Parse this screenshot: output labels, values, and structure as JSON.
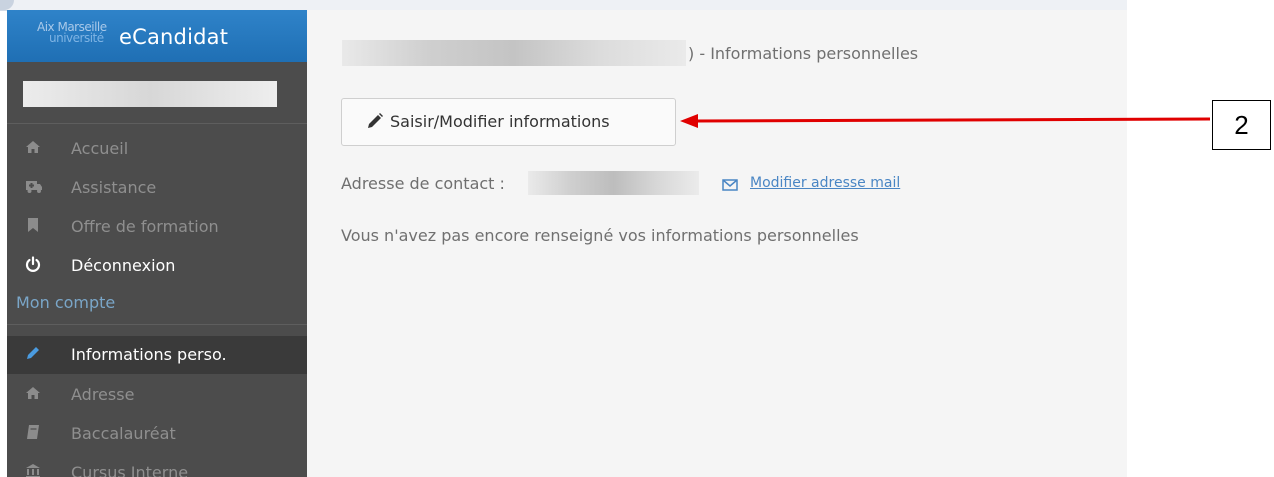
{
  "brand": {
    "logo_line1": "Aix Marseille",
    "logo_line2": "université",
    "app_name": "eCandidat"
  },
  "sidebar": {
    "items": [
      {
        "label": "Accueil",
        "icon": "home-icon"
      },
      {
        "label": "Assistance",
        "icon": "ambulance-icon"
      },
      {
        "label": "Offre de formation",
        "icon": "bookmark-icon"
      },
      {
        "label": "Déconnexion",
        "icon": "power-icon"
      }
    ],
    "section_title": "Mon compte",
    "account_items": [
      {
        "label": "Informations perso.",
        "icon": "pencil-icon",
        "active": true
      },
      {
        "label": "Adresse",
        "icon": "home-icon"
      },
      {
        "label": "Baccalauréat",
        "icon": "book-icon"
      },
      {
        "label": "Cursus Interne",
        "icon": "bank-icon"
      }
    ]
  },
  "main": {
    "title_suffix": ") - Informations personnelles",
    "edit_button_label": "Saisir/Modifier informations",
    "contact_label": "Adresse de contact :",
    "modify_mail_label": "Modifier adresse mail",
    "no_info_message": "Vous n'avez pas encore renseigné vos informations personnelles"
  },
  "annotation": {
    "callout_number": "2",
    "arrow_color": "#e00000"
  },
  "colors": {
    "brand_blue": "#2a7cc2",
    "sidebar_bg": "#4c4c4c",
    "link_blue": "#4a86c4"
  }
}
